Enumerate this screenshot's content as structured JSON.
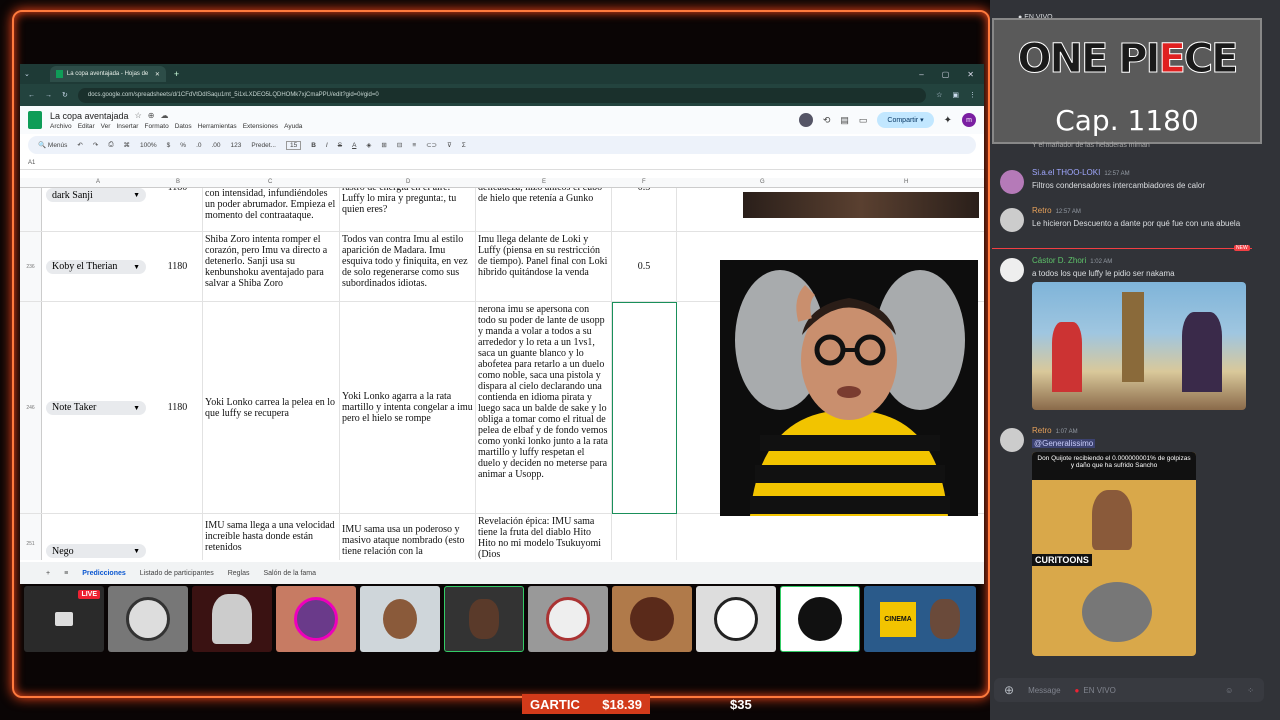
{
  "browser": {
    "tab_title": "La copa aventajada - Hojas de",
    "url": "docs.google.com/spreadsheets/d/1CFdVtDdlSaqu1mt_5i1xLXDEO5LQDHOMk7xjCmaPPU/edit?gid=0#gid=0"
  },
  "sheets": {
    "title": "La copa aventajada",
    "menus": [
      "Archivo",
      "Editar",
      "Ver",
      "Insertar",
      "Formato",
      "Datos",
      "Herramientas",
      "Extensiones",
      "Ayuda"
    ],
    "share_label": "Compartir",
    "avatar_letter": "m",
    "toolbar": {
      "menus_label": "Menús",
      "zoom": "100%",
      "currency": "$",
      "percent": "%",
      "dec_less": ".0",
      "dec_more": ".00",
      "format_num": "123",
      "font": "Predet...",
      "font_size": "15",
      "bold": "B",
      "italic": "I",
      "strike": "S",
      "text_color": "A",
      "sum": "Σ"
    },
    "cell_ref": "A1",
    "columns": [
      "A",
      "B",
      "C",
      "D",
      "E",
      "F",
      "G",
      "H"
    ],
    "rows": [
      {
        "num": "",
        "a": "dark Sanji",
        "b": "1180",
        "c": "con intensidad, infundiéndoles un poder abrumador. Empieza el momento del contraataque.",
        "d": "rastro de energía en el aire. Luffy lo mira y pregunta:, tu quien eres?",
        "e": "delicadeza, hizo añicos el cubo de hielo que retenía a Gunko",
        "f": "0.5"
      },
      {
        "num": "236",
        "a": "Koby el Therian",
        "b": "1180",
        "c": "Shiba Zoro intenta romper el corazón, pero Imu va directo a detenerlo. Sanji usa su kenbunshoku aventajado para salvar a Shiba Zoro",
        "d": "Todos van contra Imu al estilo aparición de Madara. Imu esquiva todo y finiquita, en vez de solo regenerarse como sus subordinados idiotas.",
        "e": "Imu llega delante de Loki y Luffy (piensa en su restricción de tiempo). Panel final con Loki híbrido quitándose la venda",
        "f": "0.5"
      },
      {
        "num": "246",
        "a": "Note Taker",
        "b": "1180",
        "c": "Yoki Lonko carrea la pelea en lo que luffy se recupera",
        "d": "Yoki Lonko agarra a la rata martillo y intenta congelar a imu pero el hielo se rompe",
        "e": "nerona imu se apersona con todo su poder de lante de usopp y manda a volar a todos a su arrededor y lo reta a un 1vs1, saca un guante blanco y lo abofetea para retarlo a un duelo como noble, saca una pistola y dispara al cielo declarando una contienda en idioma pirata y luego saca un balde de sake y lo obliga a tomar como el ritual de pelea de elbaf y de fondo vemos como yonki lonko junto a la rata martillo y luffy respetan el duelo y deciden no meterse para animar a Usopp.",
        "f": ""
      },
      {
        "num": "251",
        "a": "Nego",
        "b": "1180",
        "c": "IMU sama llega a una velocidad increíble hasta donde están retenidos",
        "d": "IMU sama usa un poderoso y masivo ataque nombrado (esto tiene relación con la",
        "e": "Revelación épica: IMU sama tiene la fruta del diablo Hito Hito no mi modelo Tsukuyomi (Dios",
        "f": ""
      }
    ],
    "sheet_tabs": [
      "Predicciones",
      "Listado de participantes",
      "Reglas",
      "Salón de la fama"
    ]
  },
  "webcams": {
    "live_label": "LIVE",
    "cinema_label": "CINEMA"
  },
  "ticker": {
    "game": "GARTIC",
    "price1": "$18.39",
    "price2": "$35"
  },
  "chat": {
    "top_status": "EN VIVO",
    "card": {
      "logo_part1": "ONE PI",
      "logo_part2": "E",
      "logo_part3": "CE",
      "cap": "Cap. 1180"
    },
    "partial_msg": "Y el mañador de las heladeras miman",
    "messages": [
      {
        "name": "Si.a.el THOO-LOKI",
        "time": "12:57 AM",
        "text": "Filtros condensadores intercambiadores de calor"
      },
      {
        "name": "Retro",
        "time": "12:57 AM",
        "text": "Le hicieron Descuento a dante por qué fue con una abuela"
      },
      {
        "name": "Cástor D. Zhori",
        "time": "1:02 AM",
        "text": "a todos los que luffy le pidio ser nakama"
      },
      {
        "name": "Retro",
        "time": "1:07 AM",
        "mention": "@Generalissimo",
        "meme_caption": "Don Quijote recibiendo el 0.000000001% de golpizas y daño que ha sufrido Sancho",
        "meme_label": "CURITOONS"
      }
    ],
    "new_label": "NEW",
    "input_placeholder": "Message",
    "input_status": "EN VIVO"
  }
}
